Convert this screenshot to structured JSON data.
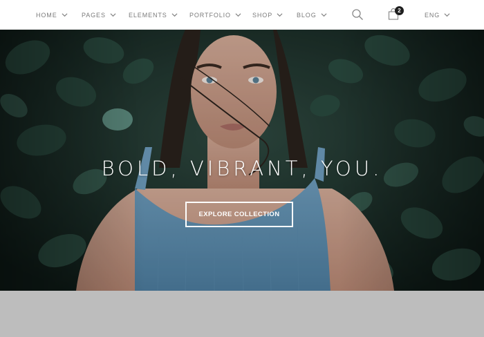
{
  "nav": {
    "items": [
      {
        "label": "HOME"
      },
      {
        "label": "PAGES"
      },
      {
        "label": "ELEMENTS"
      },
      {
        "label": "PORTFOLIO"
      },
      {
        "label": "SHOP"
      },
      {
        "label": "BLOG"
      }
    ],
    "search_icon": "search-icon",
    "cart_icon": "shopping-bag-icon",
    "cart_count": "2",
    "language": "ENG"
  },
  "hero": {
    "title": "BOLD, VIBRANT, YOU.",
    "button_label": "EXPLORE COLLECTION"
  },
  "colors": {
    "nav_text": "#7a7a7a",
    "badge_bg": "#1f1f1f",
    "hero_text": "#ffffff",
    "footer_strip": "#bdbdbd"
  }
}
